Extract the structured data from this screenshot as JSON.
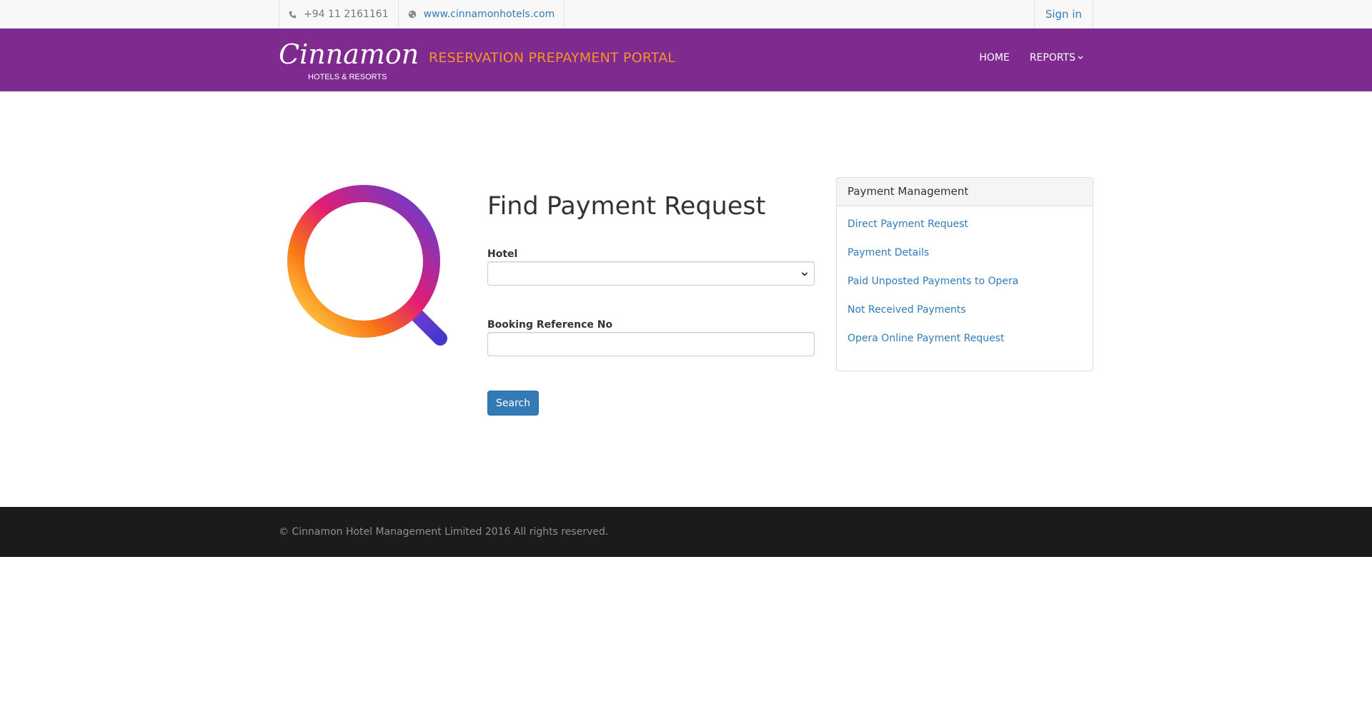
{
  "topbar": {
    "phone": "+94 11 2161161",
    "website": "www.cinnamonhotels.com",
    "signin_label": "Sign in"
  },
  "header": {
    "logo_text": "Cinnamon",
    "logo_subtext": "HOTELS & RESORTS",
    "portal_title": "RESERVATION PREPAYMENT PORTAL",
    "nav": {
      "home": "HOME",
      "reports": "REPORTS"
    }
  },
  "form": {
    "title": "Find Payment Request",
    "hotel_label": "Hotel",
    "hotel_selected": "",
    "booking_label": "Booking Reference No",
    "booking_value": "",
    "search_label": "Search"
  },
  "sidebar": {
    "heading": "Payment Management",
    "links": [
      {
        "label": "Direct Payment Request"
      },
      {
        "label": "Payment Details"
      },
      {
        "label": "Paid Unposted Payments to Opera"
      },
      {
        "label": "Not Received Payments"
      },
      {
        "label": "Opera Online Payment Request"
      }
    ]
  },
  "footer": {
    "copyright": "© Cinnamon Hotel Management Limited 2016 All rights reserved."
  },
  "colors": {
    "header_bg": "#7f2a8f",
    "portal_title": "#f5922b",
    "link": "#337ab7",
    "button": "#337ab7",
    "footer_bg": "#1b1b1b"
  },
  "icons": [
    "phone-icon",
    "globe-icon",
    "chevron-down-icon",
    "magnifier-icon"
  ]
}
